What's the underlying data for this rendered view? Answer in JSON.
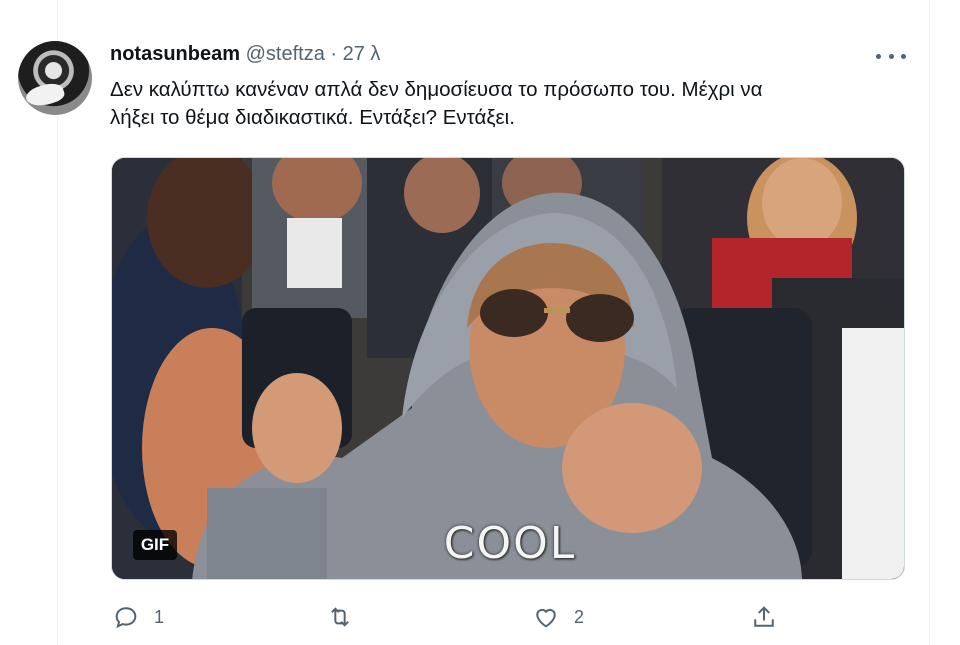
{
  "tweet": {
    "author_name": "notasunbeam",
    "handle": "@steftza",
    "separator": "·",
    "time": "27 λ",
    "text_line1": "Δεν καλύπτω κανέναν απλά δεν δημοσίευσα το πρόσωπο του. Μέχρι να",
    "text_line2": "λήξει το θέμα διαδικαστικά. Εντάξει? Εντάξει.",
    "media": {
      "badge": "GIF",
      "caption": "COOL"
    },
    "actions": {
      "reply_count": "1",
      "retweet_count": "",
      "like_count": "2"
    }
  },
  "icons": [
    "more-icon",
    "reply-icon",
    "retweet-icon",
    "like-icon",
    "share-icon"
  ],
  "colors": {
    "muted": "#536471",
    "text": "#0f1419",
    "border": "#cfd9de"
  }
}
